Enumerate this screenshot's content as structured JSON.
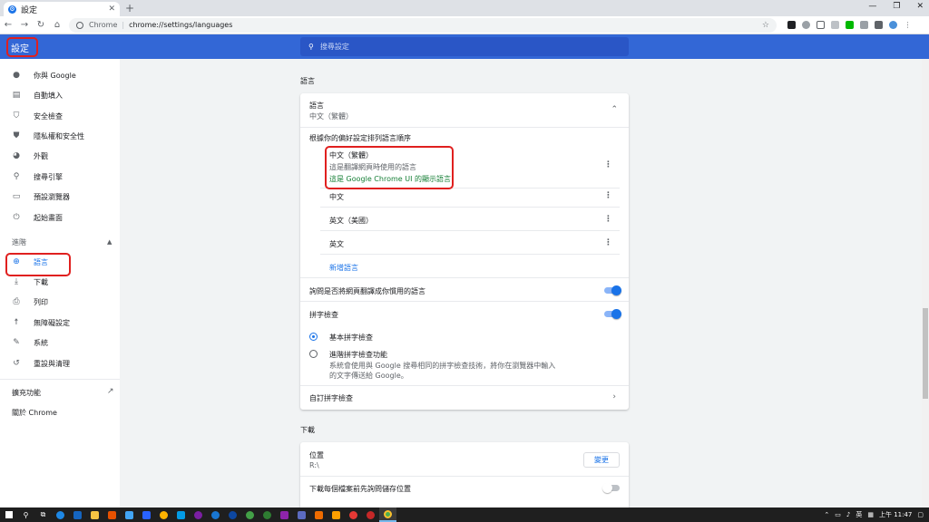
{
  "browser": {
    "tab_title": "設定",
    "tab_close": "✕",
    "new_tab": "+",
    "win_min": "—",
    "win_restore": "❐",
    "win_close": "✕",
    "origin": "Chrome",
    "url": "chrome://settings/languages"
  },
  "header": {
    "title": "設定",
    "search_placeholder": "搜尋設定"
  },
  "sidebar": {
    "items": [
      {
        "label": "你與 Google",
        "icon": "person-icon"
      },
      {
        "label": "自動填入",
        "icon": "clipboard-icon"
      },
      {
        "label": "安全檢查",
        "icon": "shield-check-icon"
      },
      {
        "label": "隱私權和安全性",
        "icon": "shield-icon"
      },
      {
        "label": "外觀",
        "icon": "palette-icon"
      },
      {
        "label": "搜尋引擎",
        "icon": "search-icon"
      },
      {
        "label": "預設瀏覽器",
        "icon": "browser-icon"
      },
      {
        "label": "起始畫面",
        "icon": "power-icon"
      }
    ],
    "advanced": "進階",
    "advanced_items": [
      {
        "label": "語言",
        "icon": "globe-icon"
      },
      {
        "label": "下載",
        "icon": "download-icon"
      },
      {
        "label": "列印",
        "icon": "print-icon"
      },
      {
        "label": "無障礙設定",
        "icon": "accessibility-icon"
      },
      {
        "label": "系統",
        "icon": "wrench-icon"
      },
      {
        "label": "重設與清理",
        "icon": "restore-icon"
      }
    ],
    "extensions": "擴充功能",
    "about": "關於 Chrome"
  },
  "languages_section": {
    "title": "語言",
    "header_label": "語言",
    "header_value": "中文（繁體）",
    "order_label": "根據你的偏好設定排列語言順序",
    "languages": [
      {
        "name": "中文（繁體）",
        "note1": "這是翻譯網頁時使用的語言",
        "note2": "這是 Google Chrome UI 的顯示語言"
      },
      {
        "name": "中文"
      },
      {
        "name": "英文（美國）"
      },
      {
        "name": "英文"
      }
    ],
    "add_language": "新增語言",
    "offer_translate": "詢問是否將網頁翻譯成你慣用的語言",
    "spell_check": "拼字檢查",
    "basic_spell": "基本拼字檢查",
    "enhanced_spell": "進階拼字檢查功能",
    "enhanced_desc1": "系統會使用與 Google 搜尋相同的拼字檢查技術，將你在瀏覽器中輸入",
    "enhanced_desc2": "的文字傳送給 Google。",
    "custom_spell": "自訂拼字檢查"
  },
  "downloads_section": {
    "title": "下載",
    "location_label": "位置",
    "location_value": "R:\\",
    "change_button": "變更",
    "ask_where": "下載每個檔案前先詢問儲存位置"
  },
  "taskbar": {
    "tray_lang": "英",
    "time": "上午 11:47"
  },
  "colors": {
    "accent": "#1a73e8",
    "header": "#3367d6",
    "highlight": "#e0201f"
  }
}
